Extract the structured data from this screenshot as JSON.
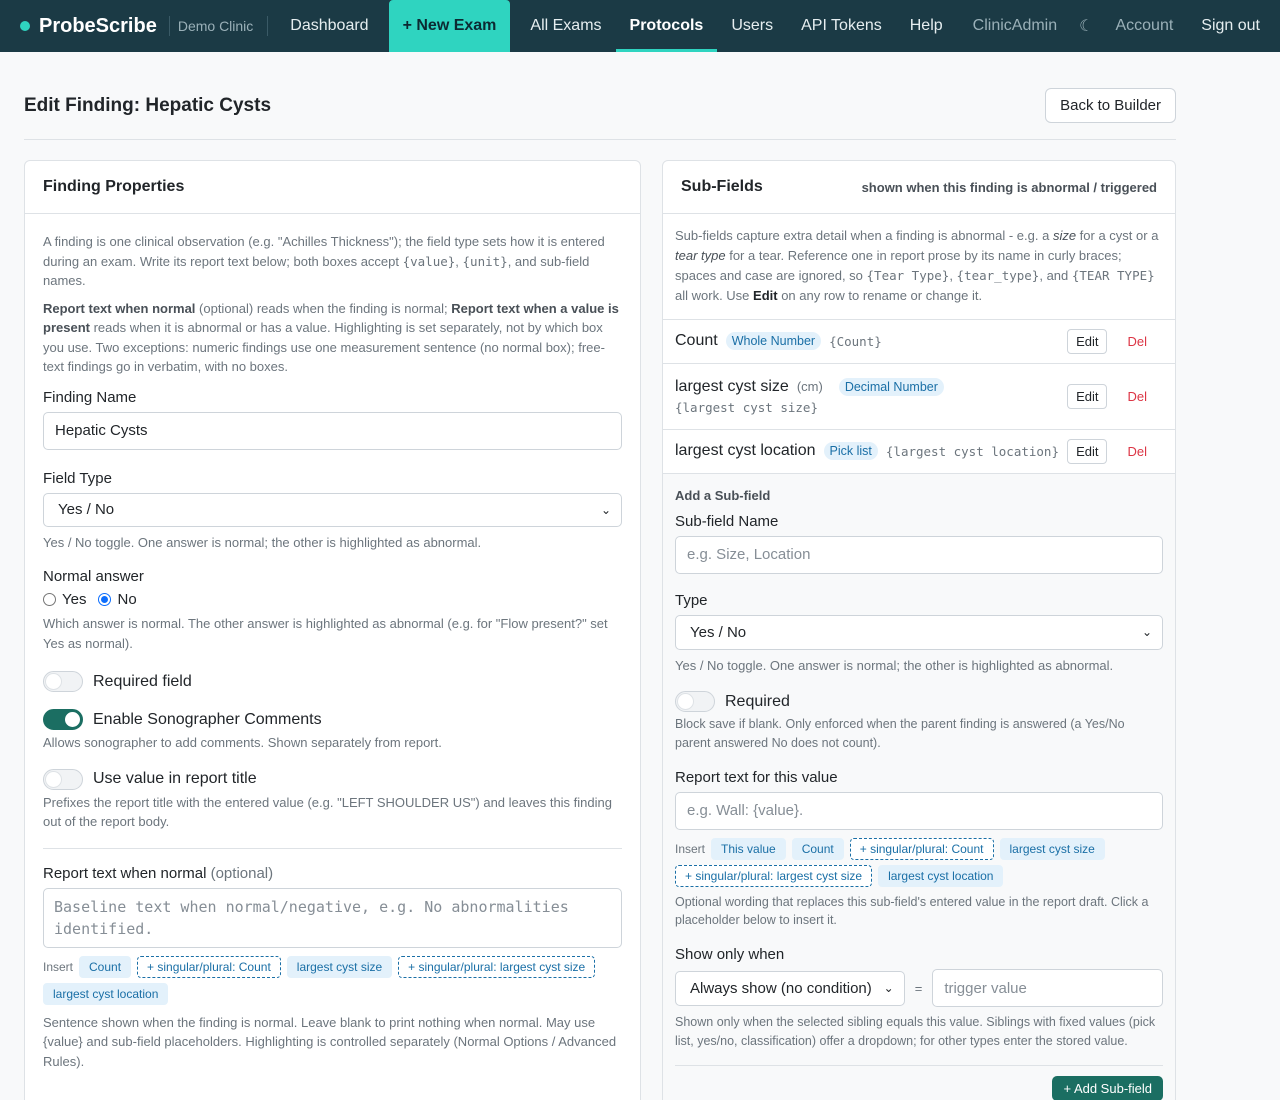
{
  "nav": {
    "brand": "ProbeScribe",
    "clinic": "Demo Clinic",
    "items": [
      "Dashboard",
      "+ New Exam",
      "All Exams",
      "Protocols",
      "Users",
      "API Tokens",
      "Help"
    ],
    "right": [
      "ClinicAdmin",
      "Account",
      "Sign out"
    ]
  },
  "page": {
    "title": "Edit Finding: Hepatic Cysts",
    "back_button": "Back to Builder"
  },
  "left": {
    "title": "Finding Properties",
    "intro1_a": "A finding is one clinical observation (e.g. \"Achilles Thickness\"); the field type sets how it is entered during an exam. Write its report text below; both boxes accept ",
    "intro1_code1": "{value}",
    "intro1_b": ", ",
    "intro1_code2": "{unit}",
    "intro1_c": ", and sub-field names.",
    "intro2_b1": "Report text when normal",
    "intro2_a": " (optional) reads when the finding is normal; ",
    "intro2_b2": "Report text when a value is present",
    "intro2_c": " reads when it is abnormal or has a value. Highlighting is set separately, not by which box you use. Two exceptions: numeric findings use one measurement sentence (no normal box); free-text findings go in verbatim, with no boxes.",
    "finding_name_label": "Finding Name",
    "finding_name_value": "Hepatic Cysts",
    "field_type_label": "Field Type",
    "field_type_value": "Yes / No",
    "field_type_help": "Yes / No toggle. One answer is normal; the other is highlighted as abnormal.",
    "normal_answer_label": "Normal answer",
    "radio_yes": "Yes",
    "radio_no": "No",
    "normal_answer_help": "Which answer is normal. The other answer is highlighted as abnormal (e.g. for \"Flow present?\" set Yes as normal).",
    "required_label": "Required field",
    "comments_label": "Enable Sonographer Comments",
    "comments_help": "Allows sonographer to add comments. Shown separately from report.",
    "title_value_label": "Use value in report title",
    "title_value_help": "Prefixes the report title with the entered value (e.g. \"LEFT SHOULDER US\") and leaves this finding out of the report body.",
    "normal_text_label": "Report text when normal",
    "normal_text_optional": "(optional)",
    "normal_text_placeholder": "Baseline text when normal/negative, e.g. No abnormalities identified.",
    "insert_label": "Insert",
    "insert_chips": [
      "Count",
      "+ singular/plural: Count",
      "largest cyst size",
      "+ singular/plural: largest cyst size",
      "largest cyst location"
    ],
    "normal_text_help": "Sentence shown when the finding is normal. Leave blank to print nothing when normal. May use {value} and sub-field placeholders. Highlighting is controlled separately (Normal Options / Advanced Rules)."
  },
  "right": {
    "title": "Sub-Fields",
    "subtitle": "shown when this finding is abnormal / triggered",
    "intro_a": "Sub-fields capture extra detail when a finding is abnormal - e.g. a ",
    "intro_i1": "size",
    "intro_b": " for a cyst or a ",
    "intro_i2": "tear type",
    "intro_c": " for a tear. Reference one in report prose by its name in curly braces; spaces and case are ignored, so ",
    "intro_code1": "{Tear Type}",
    "intro_d": ", ",
    "intro_code2": "{tear_type}",
    "intro_e": ", and ",
    "intro_code3": "{TEAR TYPE}",
    "intro_f": " all work. Use ",
    "intro_bold": "Edit",
    "intro_g": " on any row to rename or change it.",
    "subfields": [
      {
        "name": "Count",
        "unit": "",
        "type": "Whole Number",
        "placeholder": "{Count}"
      },
      {
        "name": "largest cyst size",
        "unit": "(cm)",
        "type": "Decimal Number",
        "placeholder": "{largest cyst size}"
      },
      {
        "name": "largest cyst location",
        "unit": "",
        "type": "Pick list",
        "placeholder": "{largest cyst location}"
      }
    ],
    "edit_label": "Edit",
    "del_label": "Del",
    "add_title": "Add a Sub-field",
    "name_label": "Sub-field Name",
    "name_placeholder": "e.g. Size, Location",
    "type_label": "Type",
    "type_value": "Yes / No",
    "type_help": "Yes / No toggle. One answer is normal; the other is highlighted as abnormal.",
    "required_label": "Required",
    "required_help": "Block save if blank. Only enforced when the parent finding is answered (a Yes/No parent answered No does not count).",
    "report_text_label": "Report text for this value",
    "report_text_placeholder": "e.g. Wall: {value}.",
    "insert_label": "Insert",
    "insert_chips": [
      "This value",
      "Count",
      "+ singular/plural: Count",
      "largest cyst size",
      "+ singular/plural: largest cyst size",
      "largest cyst location"
    ],
    "report_text_help": "Optional wording that replaces this sub-field's entered value in the report draft. Click a placeholder below to insert it.",
    "show_when_label": "Show only when",
    "show_when_value": "Always show (no condition)",
    "equals": "=",
    "trigger_placeholder": "trigger value",
    "show_when_help": "Shown only when the selected sibling equals this value. Siblings with fixed values (pick list, yes/no, classification) offer a dropdown; for other types enter the stored value.",
    "add_button": "+ Add Sub-field"
  },
  "colors": {
    "navbar": "#1b3a45",
    "accent": "#2fd4c0",
    "toggle_on": "#1b6e62",
    "danger": "#dc3545",
    "chip": "#e3f1fb"
  }
}
